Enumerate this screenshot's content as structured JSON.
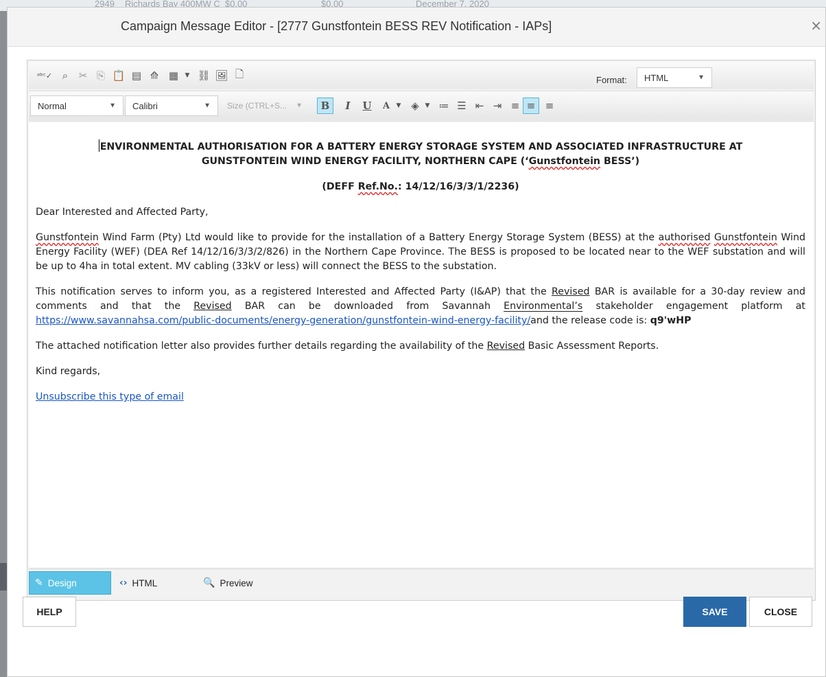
{
  "background": {
    "strip_text": [
      "2949",
      "Richards Bay 400MW C",
      "$0.00",
      "$0.00",
      "December 7, 2020"
    ]
  },
  "dialog": {
    "title": "Campaign Message Editor - [2777 Gunstfontein BESS REV Notification - IAPs]",
    "close_glyph": "×"
  },
  "toolbar": {
    "format_label": "Format:",
    "format_value": "HTML",
    "paragraph_style": "Normal",
    "font_name": "Calibri",
    "size_placeholder": "Size (CTRL+S..."
  },
  "content": {
    "heading_line1": "ENVIRONMENTAL AUTHORISATION FOR A BATTERY ENERGY STORAGE SYSTEM AND ASSOCIATED INFRASTRUCTURE AT",
    "heading_line2_pre": "GUNSTFONTEIN WIND ENERGY FACILITY, NORTHERN CAPE (‘",
    "heading_line2_sq": "Gunstfontein",
    "heading_line2_post": " BESS’)",
    "ref_pre": "(DEFF ",
    "ref_sq": "Ref.No.",
    "ref_post": ": 14/12/16/3/3/1/2236)",
    "greeting": "Dear Interested and Affected Party,",
    "p1_sq1": "Gunstfontein",
    "p1_a": " Wind Farm (Pty) Ltd would like to provide for the installation of a Battery Energy Storage System (BESS) at the ",
    "p1_sq2": "authorised",
    "p1_b": " ",
    "p1_sq3": "Gunstfontein",
    "p1_c": " Wind Energy Facility (WEF) (DEA Ref 14/12/16/3/3/2/826) in the Northern Cape Province.  The BESS is proposed to be located near to the WEF substation and will be up to 4ha in total extent.  MV cabling (33kV or less) will connect the BESS to the substation.",
    "p2_a": "This notification serves to inform you, as a registered Interested and Affected Party (I&AP) that the ",
    "p2_u1": "Revised",
    "p2_b": " BAR is available for a 30-day review and comments and that the ",
    "p2_u2": "Revised",
    "p2_c": " BAR can be downloaded from Savannah ",
    "p2_sq": "Environmental’s",
    "p2_d": " stakeholder engagement platform at ",
    "p2_link": "https://www.savannahsa.com/public-documents/energy-generation/gunstfontein-wind-energy-facility/",
    "p2_e": "and the release code is: ",
    "p2_code": "q9'wHP",
    "p3_a": "The attached notification letter also provides further details regarding the availability of the ",
    "p3_u": "Revised",
    "p3_b": " Basic Assessment Reports.",
    "closing": "Kind regards,",
    "unsubscribe": "Unsubscribe this type of email"
  },
  "modes": {
    "design": "Design",
    "html": "HTML",
    "preview": "Preview"
  },
  "footer": {
    "help": "HELP",
    "save": "SAVE",
    "close": "CLOSE"
  }
}
